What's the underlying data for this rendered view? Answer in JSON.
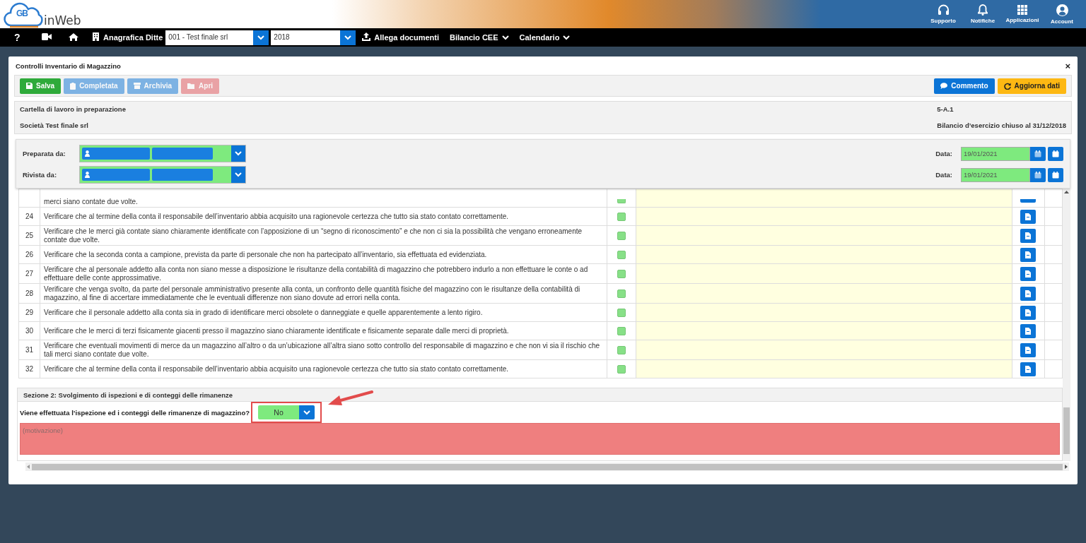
{
  "header": {
    "logo_mark": "GB",
    "logo_text": "inWeb",
    "actions": [
      {
        "label": "Supporto"
      },
      {
        "label": "Notifiche"
      },
      {
        "label": "Applicazioni"
      },
      {
        "label": "Account"
      }
    ]
  },
  "nav": {
    "help": "?",
    "registry": "Anagrafica Ditte",
    "company": "001 - Test finale srl",
    "year": "2018",
    "attach": "Allega documenti",
    "menus": [
      {
        "label": "Bilancio CEE"
      },
      {
        "label": "Calendario"
      }
    ]
  },
  "modal": {
    "title": "Controlli Inventario di Magazzino",
    "close": "×",
    "toolbar_left": [
      {
        "label": "Salva",
        "kind": "success",
        "disabled": false
      },
      {
        "label": "Completata",
        "kind": "primary",
        "disabled": true
      },
      {
        "label": "Archivia",
        "kind": "primary",
        "disabled": true
      },
      {
        "label": "Apri",
        "kind": "danger",
        "disabled": true
      }
    ],
    "toolbar_right": [
      {
        "label": "Commento",
        "kind": "primary",
        "disabled": false
      },
      {
        "label": "Aggiorna dati",
        "kind": "warning",
        "disabled": false
      }
    ],
    "info": {
      "status": "Cartella di lavoro in preparazione",
      "code": "5-A.1",
      "company": "Società Test finale srl",
      "period": "Bilancio d’esercizio chiuso al 31/12/2018"
    },
    "assignments": [
      {
        "label": "Preparata da:",
        "date_label": "Data:",
        "date": "19/01/2021"
      },
      {
        "label": "Rivista da:",
        "date_label": "Data:",
        "date": "19/01/2021"
      }
    ],
    "checklist": {
      "partial_row": {
        "text": "merci siano contate due volte.",
        "checked": true
      },
      "rows": [
        {
          "number": "24",
          "text": "Verificare che al termine della conta il responsabile dell’inventario abbia acquisito una ragionevole certezza che tutto sia stato contato correttamente.",
          "checked": true
        },
        {
          "number": "25",
          "text": "Verificare che le merci già contate siano chiaramente identificate con l’apposizione di un “segno di riconoscimento” e che non ci sia la possibilità che vengano erroneamente contate due volte.",
          "checked": true
        },
        {
          "number": "26",
          "text": "Verificare che la seconda conta a campione, prevista da parte di personale che non ha partecipato all’inventario, sia effettuata ed evidenziata.",
          "checked": true
        },
        {
          "number": "27",
          "text": "Verificare che al personale addetto alla conta non siano messe a disposizione le risultanze della contabilità di magazzino che potrebbero indurlo a non effettuare le conte o ad effettuare delle conte approssimative.",
          "checked": true
        },
        {
          "number": "28",
          "text": "Verificare che venga svolto, da parte del personale amministrativo presente alla conta, un confronto delle quantità fisiche del magazzino con le risultanze della contabilità di magazzino, al fine di accertare immediatamente che le eventuali differenze non siano dovute ad errori nella conta.",
          "checked": true
        },
        {
          "number": "29",
          "text": "Verificare che il personale addetto alla conta sia in grado di identificare merci obsolete o danneggiate e quelle apparentemente a lento rigiro.",
          "checked": true
        },
        {
          "number": "30",
          "text": "Verificare che le merci di terzi fisicamente giacenti presso il magazzino siano chiaramente identificate e fisicamente separate dalle merci di proprietà.",
          "checked": true
        },
        {
          "number": "31",
          "text": "Verificare che eventuali movimenti di merce da un magazzino all’altro o da un’ubicazione all’altra siano sotto controllo del responsabile di magazzino e che non vi sia il rischio che tali merci siano contate due volte.",
          "checked": true
        },
        {
          "number": "32",
          "text": "Verificare che al termine della conta il responsabile dell’inventario abbia acquisito una ragionevole certezza che tutto sia stato contato correttamente.",
          "checked": true
        }
      ]
    },
    "section": {
      "title": "Sezione 2: Svolgimento di ispezioni e di conteggi delle rimanenze",
      "question": "Viene effettuata l’ispezione ed i conteggi delle rimanenze di magazzino?",
      "answer": "No",
      "motivation_placeholder": "(motivazione)"
    }
  }
}
